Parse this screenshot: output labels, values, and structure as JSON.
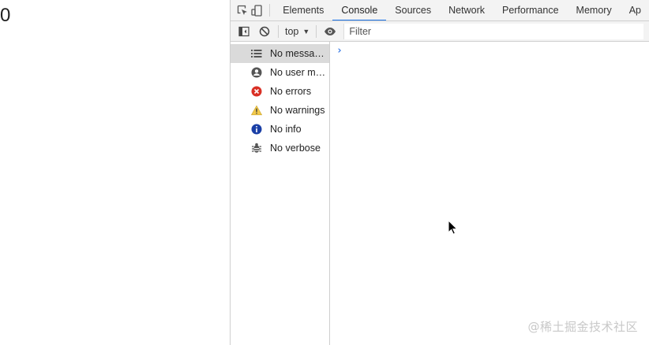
{
  "page": {
    "counter_value": "0"
  },
  "devtools": {
    "tabs": [
      {
        "label": "Elements",
        "active": false
      },
      {
        "label": "Console",
        "active": true
      },
      {
        "label": "Sources",
        "active": false
      },
      {
        "label": "Network",
        "active": false
      },
      {
        "label": "Performance",
        "active": false
      },
      {
        "label": "Memory",
        "active": false
      },
      {
        "label": "Ap",
        "active": false
      }
    ],
    "toolbar": {
      "context": "top",
      "filter_placeholder": "Filter"
    },
    "sidebar": {
      "items": [
        {
          "label": "No messages",
          "icon": "list-icon",
          "selected": true
        },
        {
          "label": "No user me…",
          "icon": "user-icon",
          "selected": false
        },
        {
          "label": "No errors",
          "icon": "error-icon",
          "selected": false
        },
        {
          "label": "No warnings",
          "icon": "warning-icon",
          "selected": false
        },
        {
          "label": "No info",
          "icon": "info-icon",
          "selected": false
        },
        {
          "label": "No verbose",
          "icon": "bug-icon",
          "selected": false
        }
      ]
    },
    "console": {
      "prompt": "›"
    },
    "colors": {
      "accent": "#1a73e8",
      "error": "#d93025",
      "warning": "#f2c94c",
      "info": "#1a3fa6"
    }
  },
  "watermark": "@稀土掘金技术社区"
}
